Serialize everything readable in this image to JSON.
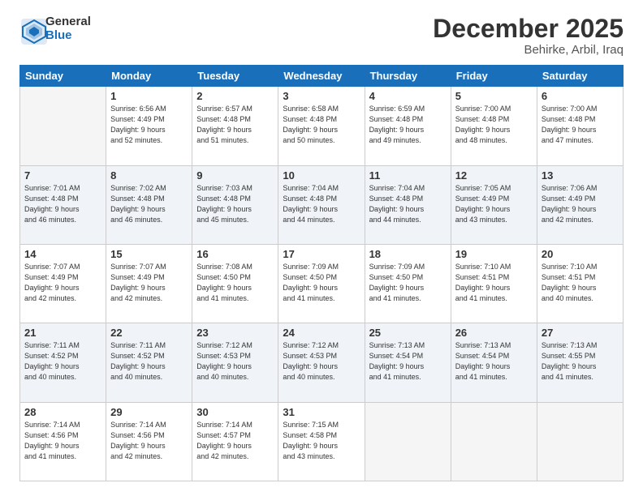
{
  "header": {
    "logo_line1": "General",
    "logo_line2": "Blue",
    "month": "December 2025",
    "location": "Behirke, Arbil, Iraq"
  },
  "days_of_week": [
    "Sunday",
    "Monday",
    "Tuesday",
    "Wednesday",
    "Thursday",
    "Friday",
    "Saturday"
  ],
  "weeks": [
    [
      {
        "day": "",
        "info": ""
      },
      {
        "day": "1",
        "info": "Sunrise: 6:56 AM\nSunset: 4:49 PM\nDaylight: 9 hours\nand 52 minutes."
      },
      {
        "day": "2",
        "info": "Sunrise: 6:57 AM\nSunset: 4:48 PM\nDaylight: 9 hours\nand 51 minutes."
      },
      {
        "day": "3",
        "info": "Sunrise: 6:58 AM\nSunset: 4:48 PM\nDaylight: 9 hours\nand 50 minutes."
      },
      {
        "day": "4",
        "info": "Sunrise: 6:59 AM\nSunset: 4:48 PM\nDaylight: 9 hours\nand 49 minutes."
      },
      {
        "day": "5",
        "info": "Sunrise: 7:00 AM\nSunset: 4:48 PM\nDaylight: 9 hours\nand 48 minutes."
      },
      {
        "day": "6",
        "info": "Sunrise: 7:00 AM\nSunset: 4:48 PM\nDaylight: 9 hours\nand 47 minutes."
      }
    ],
    [
      {
        "day": "7",
        "info": "Sunrise: 7:01 AM\nSunset: 4:48 PM\nDaylight: 9 hours\nand 46 minutes."
      },
      {
        "day": "8",
        "info": "Sunrise: 7:02 AM\nSunset: 4:48 PM\nDaylight: 9 hours\nand 46 minutes."
      },
      {
        "day": "9",
        "info": "Sunrise: 7:03 AM\nSunset: 4:48 PM\nDaylight: 9 hours\nand 45 minutes."
      },
      {
        "day": "10",
        "info": "Sunrise: 7:04 AM\nSunset: 4:48 PM\nDaylight: 9 hours\nand 44 minutes."
      },
      {
        "day": "11",
        "info": "Sunrise: 7:04 AM\nSunset: 4:48 PM\nDaylight: 9 hours\nand 44 minutes."
      },
      {
        "day": "12",
        "info": "Sunrise: 7:05 AM\nSunset: 4:49 PM\nDaylight: 9 hours\nand 43 minutes."
      },
      {
        "day": "13",
        "info": "Sunrise: 7:06 AM\nSunset: 4:49 PM\nDaylight: 9 hours\nand 42 minutes."
      }
    ],
    [
      {
        "day": "14",
        "info": "Sunrise: 7:07 AM\nSunset: 4:49 PM\nDaylight: 9 hours\nand 42 minutes."
      },
      {
        "day": "15",
        "info": "Sunrise: 7:07 AM\nSunset: 4:49 PM\nDaylight: 9 hours\nand 42 minutes."
      },
      {
        "day": "16",
        "info": "Sunrise: 7:08 AM\nSunset: 4:50 PM\nDaylight: 9 hours\nand 41 minutes."
      },
      {
        "day": "17",
        "info": "Sunrise: 7:09 AM\nSunset: 4:50 PM\nDaylight: 9 hours\nand 41 minutes."
      },
      {
        "day": "18",
        "info": "Sunrise: 7:09 AM\nSunset: 4:50 PM\nDaylight: 9 hours\nand 41 minutes."
      },
      {
        "day": "19",
        "info": "Sunrise: 7:10 AM\nSunset: 4:51 PM\nDaylight: 9 hours\nand 41 minutes."
      },
      {
        "day": "20",
        "info": "Sunrise: 7:10 AM\nSunset: 4:51 PM\nDaylight: 9 hours\nand 40 minutes."
      }
    ],
    [
      {
        "day": "21",
        "info": "Sunrise: 7:11 AM\nSunset: 4:52 PM\nDaylight: 9 hours\nand 40 minutes."
      },
      {
        "day": "22",
        "info": "Sunrise: 7:11 AM\nSunset: 4:52 PM\nDaylight: 9 hours\nand 40 minutes."
      },
      {
        "day": "23",
        "info": "Sunrise: 7:12 AM\nSunset: 4:53 PM\nDaylight: 9 hours\nand 40 minutes."
      },
      {
        "day": "24",
        "info": "Sunrise: 7:12 AM\nSunset: 4:53 PM\nDaylight: 9 hours\nand 40 minutes."
      },
      {
        "day": "25",
        "info": "Sunrise: 7:13 AM\nSunset: 4:54 PM\nDaylight: 9 hours\nand 41 minutes."
      },
      {
        "day": "26",
        "info": "Sunrise: 7:13 AM\nSunset: 4:54 PM\nDaylight: 9 hours\nand 41 minutes."
      },
      {
        "day": "27",
        "info": "Sunrise: 7:13 AM\nSunset: 4:55 PM\nDaylight: 9 hours\nand 41 minutes."
      }
    ],
    [
      {
        "day": "28",
        "info": "Sunrise: 7:14 AM\nSunset: 4:56 PM\nDaylight: 9 hours\nand 41 minutes."
      },
      {
        "day": "29",
        "info": "Sunrise: 7:14 AM\nSunset: 4:56 PM\nDaylight: 9 hours\nand 42 minutes."
      },
      {
        "day": "30",
        "info": "Sunrise: 7:14 AM\nSunset: 4:57 PM\nDaylight: 9 hours\nand 42 minutes."
      },
      {
        "day": "31",
        "info": "Sunrise: 7:15 AM\nSunset: 4:58 PM\nDaylight: 9 hours\nand 43 minutes."
      },
      {
        "day": "",
        "info": ""
      },
      {
        "day": "",
        "info": ""
      },
      {
        "day": "",
        "info": ""
      }
    ]
  ]
}
